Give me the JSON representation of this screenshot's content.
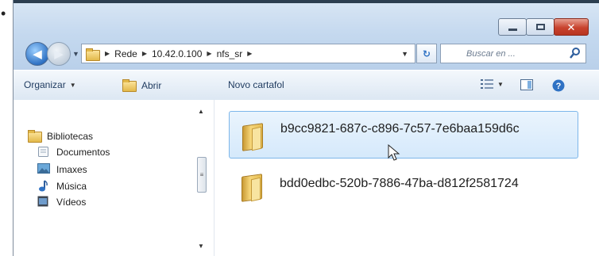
{
  "window": {
    "caption_buttons": {
      "minimize": "minimize",
      "maximize": "maximize",
      "close": "✕"
    }
  },
  "address_bar": {
    "crumbs": [
      "Rede",
      "10.42.0.100",
      "nfs_sr"
    ]
  },
  "search": {
    "placeholder": "Buscar en ..."
  },
  "toolbar": {
    "organize": "Organizar",
    "open": "Abrir",
    "new_folder": "Novo cartafol"
  },
  "nav_pane": {
    "libraries": "Bibliotecas",
    "items": [
      "Documentos",
      "Imaxes",
      "Música",
      "Vídeos"
    ]
  },
  "files": [
    {
      "name": "b9cc9821-687c-c896-7c57-7e6baa159d6c",
      "selected": true
    },
    {
      "name": "bdd0edbc-520b-7886-47ba-d812f2581724",
      "selected": false
    }
  ],
  "colors": {
    "selection": "#d5e9fb",
    "selection_border": "#7db6ea",
    "close": "#c8432e"
  }
}
